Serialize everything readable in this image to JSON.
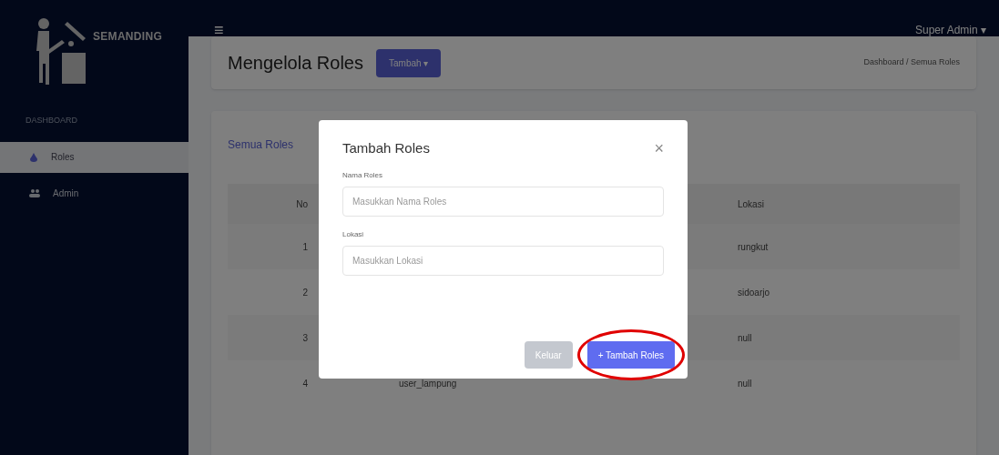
{
  "brand": {
    "name": "SEMANDING"
  },
  "topbar": {
    "menu_glyph": "≡",
    "user": "Super Admin",
    "caret": "▾"
  },
  "sidebar": {
    "heading": "DASHBOARD",
    "items": [
      {
        "label": "Roles",
        "selected": true
      },
      {
        "label": "Admin",
        "selected": false
      }
    ]
  },
  "header": {
    "title": "Mengelola Roles",
    "button": "Tambah",
    "button_caret": "▾",
    "breadcrumb": "Dashboard / Semua Roles"
  },
  "card": {
    "title": "Semua Roles",
    "columns": [
      "No",
      "Lokasi"
    ],
    "rows": [
      {
        "no": "1",
        "lokasi": "rungkut"
      },
      {
        "no": "2",
        "lokasi": "sidoarjo"
      },
      {
        "no": "3",
        "lokasi": "null"
      },
      {
        "no": "4",
        "name": "user_lampung",
        "lokasi": "null"
      }
    ]
  },
  "modal": {
    "title": "Tambah Roles",
    "close": "×",
    "fields": [
      {
        "label": "Nama Roles",
        "placeholder": "Masukkan Nama Roles"
      },
      {
        "label": "Lokasi",
        "placeholder": "Masukkan Lokasi"
      }
    ],
    "buttons": [
      {
        "label": "Keluar",
        "kind": "secondary",
        "highlighted": false
      },
      {
        "label": "+ Tambah Roles",
        "kind": "primary",
        "highlighted": true
      }
    ]
  }
}
